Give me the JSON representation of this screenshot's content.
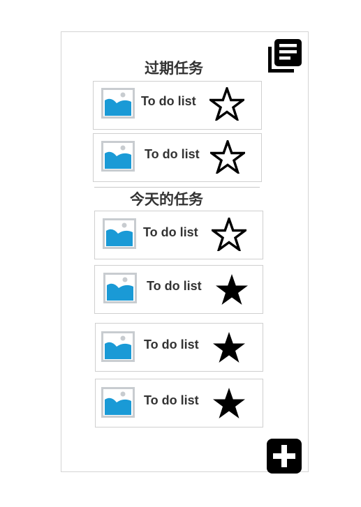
{
  "sections": {
    "overdue": {
      "title": "过期任务",
      "items": [
        {
          "label": "To do list",
          "starred": false
        },
        {
          "label": "To do list",
          "starred": false
        }
      ]
    },
    "today": {
      "title": "今天的任务",
      "items": [
        {
          "label": "To do list",
          "starred": false
        },
        {
          "label": "To do list",
          "starred": true
        },
        {
          "label": "To do list",
          "starred": true
        },
        {
          "label": "To do list",
          "starred": true
        }
      ]
    }
  },
  "icons": {
    "top_right": "library-books-icon",
    "bottom_right": "add-icon",
    "thumbnail": "image-placeholder-icon",
    "star": "star-icon"
  },
  "colors": {
    "thumbnail_blue": "#1a9ad6",
    "thumbnail_frame": "#c8ccd0",
    "text": "#333333",
    "icon": "#000000"
  }
}
